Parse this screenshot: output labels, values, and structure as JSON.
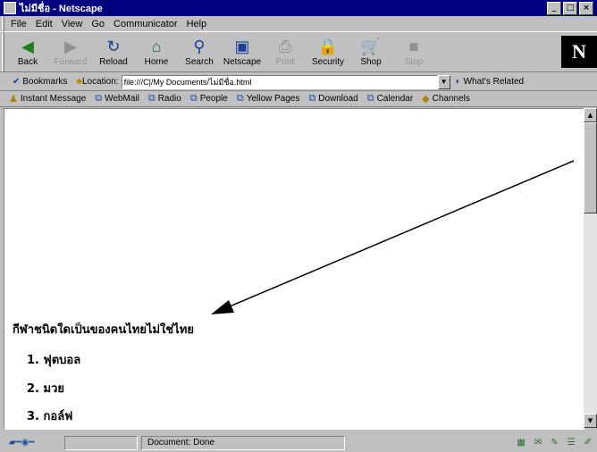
{
  "window": {
    "title": "ไม่มีชื่อ - Netscape",
    "min": "_",
    "max": "□",
    "close": "×"
  },
  "menu": [
    "File",
    "Edit",
    "View",
    "Go",
    "Communicator",
    "Help"
  ],
  "nav": [
    {
      "label": "Back",
      "icon": "back-arrow-icon",
      "glyph": "◀",
      "enabled": true
    },
    {
      "label": "Forward",
      "icon": "forward-arrow-icon",
      "glyph": "▶",
      "enabled": false
    },
    {
      "label": "Reload",
      "icon": "reload-icon",
      "glyph": "↻",
      "enabled": true
    },
    {
      "label": "Home",
      "icon": "home-icon",
      "glyph": "⌂",
      "enabled": true
    },
    {
      "label": "Search",
      "icon": "search-icon",
      "glyph": "⚲",
      "enabled": true
    },
    {
      "label": "Netscape",
      "icon": "netscape-icon",
      "glyph": "▣",
      "enabled": true
    },
    {
      "label": "Print",
      "icon": "print-icon",
      "glyph": "⎙",
      "enabled": false
    },
    {
      "label": "Security",
      "icon": "security-icon",
      "glyph": "🔒",
      "enabled": true
    },
    {
      "label": "Shop",
      "icon": "shop-icon",
      "glyph": "🛒",
      "enabled": true
    },
    {
      "label": "Stop",
      "icon": "stop-icon",
      "glyph": "■",
      "enabled": false
    }
  ],
  "logo": "N",
  "location": {
    "bookmarks_label": "Bookmarks",
    "location_label": "Location:",
    "url": "file:///C|/My Documents/ไม่มีชื่อ.html",
    "related_label": "What's Related"
  },
  "personal": [
    "Instant Message",
    "WebMail",
    "Radio",
    "People",
    "Yellow Pages",
    "Download",
    "Calendar",
    "Channels"
  ],
  "content": {
    "question": "กีฬาชนิดใดเป็นของคนไทยไม่ใช่ไทย",
    "items": [
      "1. ฟุตบอล",
      "2. มวย",
      "3. กอล์ฟ"
    ]
  },
  "status": {
    "text": "Document: Done"
  },
  "colors": {
    "titlebar": "#000080",
    "chrome": "#c0c0c0",
    "content": "#ffffff"
  }
}
